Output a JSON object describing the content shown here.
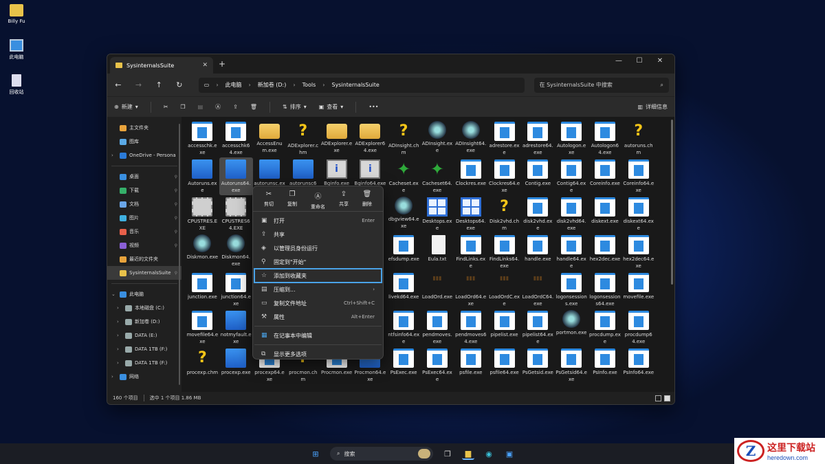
{
  "desktop": {
    "icons": [
      {
        "label": "Billy Fu",
        "icon": "folder-icon"
      },
      {
        "label": "此电脑",
        "icon": "computer-icon"
      },
      {
        "label": "回收站",
        "icon": "recycle-bin-icon"
      }
    ]
  },
  "window": {
    "tab_title": "SysinternalsSuite",
    "new_tab": "+",
    "controls": {
      "minimize": "—",
      "maximize": "☐",
      "close": "✕"
    }
  },
  "address": {
    "crumbs": [
      "此电脑",
      "新加卷 (D:)",
      "Tools",
      "SysinternalsSuite"
    ],
    "search_placeholder": "在 SysinternalsSuite 中搜索"
  },
  "toolbar": {
    "new": "新建",
    "sort": "排序",
    "view": "查看",
    "more": "•••",
    "details": "详细信息"
  },
  "sidebar": {
    "items": [
      {
        "label": "主文件夹",
        "color": "#e8a33c"
      },
      {
        "label": "图库",
        "color": "#5aa9e6"
      },
      {
        "label": "OneDrive - Persona",
        "color": "#2b7bd8"
      },
      {
        "label": "桌面",
        "color": "#3a8fe0"
      },
      {
        "label": "下载",
        "color": "#35b06a"
      },
      {
        "label": "文档",
        "color": "#6aa6e8"
      },
      {
        "label": "图片",
        "color": "#3fb0e0"
      },
      {
        "label": "音乐",
        "color": "#e8604a"
      },
      {
        "label": "视频",
        "color": "#8a5fd6"
      },
      {
        "label": "最近的文件夹",
        "color": "#e8a33c"
      },
      {
        "label": "SysinternalsSuite",
        "color": "#e8c24a"
      },
      {
        "label": "此电脑",
        "color": "#3a8fe0"
      },
      {
        "label": "本地磁盘 (C:)",
        "color": "#9aa"
      },
      {
        "label": "新加卷 (D:)",
        "color": "#9aa"
      },
      {
        "label": "DATA (E:)",
        "color": "#9aa"
      },
      {
        "label": "DATA 1TB (F:)",
        "color": "#9aa"
      },
      {
        "label": "DATA 1TB (F:)",
        "color": "#9aa"
      },
      {
        "label": "网络",
        "color": "#3a8fe0"
      }
    ]
  },
  "files": [
    {
      "name": "accesschk.exe",
      "icon": "app"
    },
    {
      "name": "accesschk64.exe",
      "icon": "app"
    },
    {
      "name": "AccessEnum.exe",
      "icon": "folder"
    },
    {
      "name": "ADExplorer.chm",
      "icon": "help"
    },
    {
      "name": "ADExplorer.exe",
      "icon": "folder"
    },
    {
      "name": "ADExplorer64.exe",
      "icon": "folder"
    },
    {
      "name": "ADInsight.chm",
      "icon": "help"
    },
    {
      "name": "ADInsight.exe",
      "icon": "globe"
    },
    {
      "name": "ADInsight64.exe",
      "icon": "globe"
    },
    {
      "name": "adrestore.exe",
      "icon": "app"
    },
    {
      "name": "adrestore64.exe",
      "icon": "app"
    },
    {
      "name": "Autologon.exe",
      "icon": "app"
    },
    {
      "name": "Autologon64.exe",
      "icon": "app"
    },
    {
      "name": "autoruns.chm",
      "icon": "help"
    },
    {
      "name": "Autoruns.exe",
      "icon": "blue"
    },
    {
      "name": "Autoruns64.exe",
      "icon": "blue"
    },
    {
      "name": "autorunsc.exe",
      "icon": "blue"
    },
    {
      "name": "autorunsc64.exe",
      "icon": "blue"
    },
    {
      "name": "Bginfo.exe",
      "icon": "info"
    },
    {
      "name": "Bginfo64.exe",
      "icon": "info"
    },
    {
      "name": "Cacheset.exe",
      "icon": "gecko"
    },
    {
      "name": "Cacheset64.exe",
      "icon": "gecko"
    },
    {
      "name": "Clockres.exe",
      "icon": "app"
    },
    {
      "name": "Clockres64.exe",
      "icon": "app"
    },
    {
      "name": "Contig.exe",
      "icon": "app"
    },
    {
      "name": "Contig64.exe",
      "icon": "app"
    },
    {
      "name": "Coreinfo.exe",
      "icon": "app"
    },
    {
      "name": "Coreinfo64.exe",
      "icon": "app"
    },
    {
      "name": "CPUSTRES.EXE",
      "icon": "chip"
    },
    {
      "name": "CPUSTRES64.EXE",
      "icon": "chip"
    },
    {
      "name": "",
      "icon": "none"
    },
    {
      "name": "",
      "icon": "none"
    },
    {
      "name": "",
      "icon": "none"
    },
    {
      "name": "",
      "icon": "none"
    },
    {
      "name": "dbgview64.exe",
      "icon": "globe"
    },
    {
      "name": "Desktops.exe",
      "icon": "tiles"
    },
    {
      "name": "Desktops64.exe",
      "icon": "tiles"
    },
    {
      "name": "Disk2vhd.chm",
      "icon": "help"
    },
    {
      "name": "disk2vhd.exe",
      "icon": "app"
    },
    {
      "name": "disk2vhd64.exe",
      "icon": "app"
    },
    {
      "name": "diskext.exe",
      "icon": "app"
    },
    {
      "name": "diskext64.exe",
      "icon": "app"
    },
    {
      "name": "Diskmon.exe",
      "icon": "globe"
    },
    {
      "name": "Diskmon64.exe",
      "icon": "globe"
    },
    {
      "name": "",
      "icon": "none"
    },
    {
      "name": "",
      "icon": "none"
    },
    {
      "name": "",
      "icon": "none"
    },
    {
      "name": "",
      "icon": "none"
    },
    {
      "name": "efsdump.exe",
      "icon": "app"
    },
    {
      "name": "Eula.txt",
      "icon": "text"
    },
    {
      "name": "FindLinks.exe",
      "icon": "app"
    },
    {
      "name": "FindLinks64.exe",
      "icon": "app"
    },
    {
      "name": "handle.exe",
      "icon": "app"
    },
    {
      "name": "handle64.exe",
      "icon": "app"
    },
    {
      "name": "hex2dec.exe",
      "icon": "app"
    },
    {
      "name": "hex2dec64.exe",
      "icon": "app"
    },
    {
      "name": "junction.exe",
      "icon": "app"
    },
    {
      "name": "junction64.exe",
      "icon": "app"
    },
    {
      "name": "",
      "icon": "none"
    },
    {
      "name": "",
      "icon": "none"
    },
    {
      "name": "",
      "icon": "none"
    },
    {
      "name": "",
      "icon": "none"
    },
    {
      "name": "livekd64.exe",
      "icon": "app"
    },
    {
      "name": "LoadOrd.exe",
      "icon": "load"
    },
    {
      "name": "LoadOrd64.exe",
      "icon": "load"
    },
    {
      "name": "LoadOrdC.exe",
      "icon": "load"
    },
    {
      "name": "LoadOrdC64.exe",
      "icon": "load"
    },
    {
      "name": "logonsessions.exe",
      "icon": "app"
    },
    {
      "name": "logonsessions64.exe",
      "icon": "app"
    },
    {
      "name": "movefile.exe",
      "icon": "app"
    },
    {
      "name": "movefile64.exe",
      "icon": "app"
    },
    {
      "name": "notmyfault.exe",
      "icon": "blue"
    },
    {
      "name": "",
      "icon": "none"
    },
    {
      "name": "",
      "icon": "none"
    },
    {
      "name": "",
      "icon": "none"
    },
    {
      "name": "",
      "icon": "none"
    },
    {
      "name": "ntfsinfo64.exe",
      "icon": "app"
    },
    {
      "name": "pendmoves.exe",
      "icon": "app"
    },
    {
      "name": "pendmoves64.exe",
      "icon": "app"
    },
    {
      "name": "pipelist.exe",
      "icon": "app"
    },
    {
      "name": "pipelist64.exe",
      "icon": "app"
    },
    {
      "name": "portmon.exe",
      "icon": "globe"
    },
    {
      "name": "procdump.exe",
      "icon": "app"
    },
    {
      "name": "procdump64.exe",
      "icon": "app"
    },
    {
      "name": "procexp.chm",
      "icon": "help"
    },
    {
      "name": "procexp.exe",
      "icon": "blue"
    },
    {
      "name": "procexp64.exe",
      "icon": "app"
    },
    {
      "name": "procmon.chm",
      "icon": "help"
    },
    {
      "name": "Procmon.exe",
      "icon": "app"
    },
    {
      "name": "Procmon64.exe",
      "icon": "blue"
    },
    {
      "name": "PsExec.exe",
      "icon": "app"
    },
    {
      "name": "PsExec64.exe",
      "icon": "app"
    },
    {
      "name": "psfile.exe",
      "icon": "app"
    },
    {
      "name": "psfile64.exe",
      "icon": "app"
    },
    {
      "name": "PsGetsid.exe",
      "icon": "app"
    },
    {
      "name": "PsGetsid64.exe",
      "icon": "app"
    },
    {
      "name": "PsInfo.exe",
      "icon": "app"
    },
    {
      "name": "PsInfo64.exe",
      "icon": "app"
    }
  ],
  "selected_file": "Autoruns64.exe",
  "status": {
    "count": "160 个项目",
    "selection": "选中 1 个项目  1.86 MB"
  },
  "context_menu": {
    "top": [
      {
        "label": "剪切",
        "icon": "scissors-icon"
      },
      {
        "label": "复制",
        "icon": "copy-icon"
      },
      {
        "label": "重命名",
        "icon": "rename-icon"
      },
      {
        "label": "共享",
        "icon": "share-icon"
      },
      {
        "label": "删除",
        "icon": "trash-icon"
      }
    ],
    "items": [
      {
        "label": "打开",
        "shortcut": "Enter"
      },
      {
        "label": "共享",
        "shortcut": ""
      },
      {
        "label": "以管理员身份运行",
        "shortcut": ""
      },
      {
        "label": "固定到\"开始\"",
        "shortcut": ""
      },
      {
        "label": "添加到收藏夹",
        "shortcut": ""
      },
      {
        "label": "压缩到...",
        "shortcut": ""
      },
      {
        "label": "复制文件地址",
        "shortcut": "Ctrl+Shift+C"
      },
      {
        "label": "属性",
        "shortcut": "Alt+Enter"
      },
      {
        "label": "在记事本中编辑",
        "shortcut": ""
      },
      {
        "label": "显示更多选项",
        "shortcut": ""
      }
    ]
  },
  "taskbar": {
    "search": "搜索"
  },
  "watermark": {
    "name": "这里下载站",
    "url": "heredown.com",
    "logo": "Z"
  }
}
